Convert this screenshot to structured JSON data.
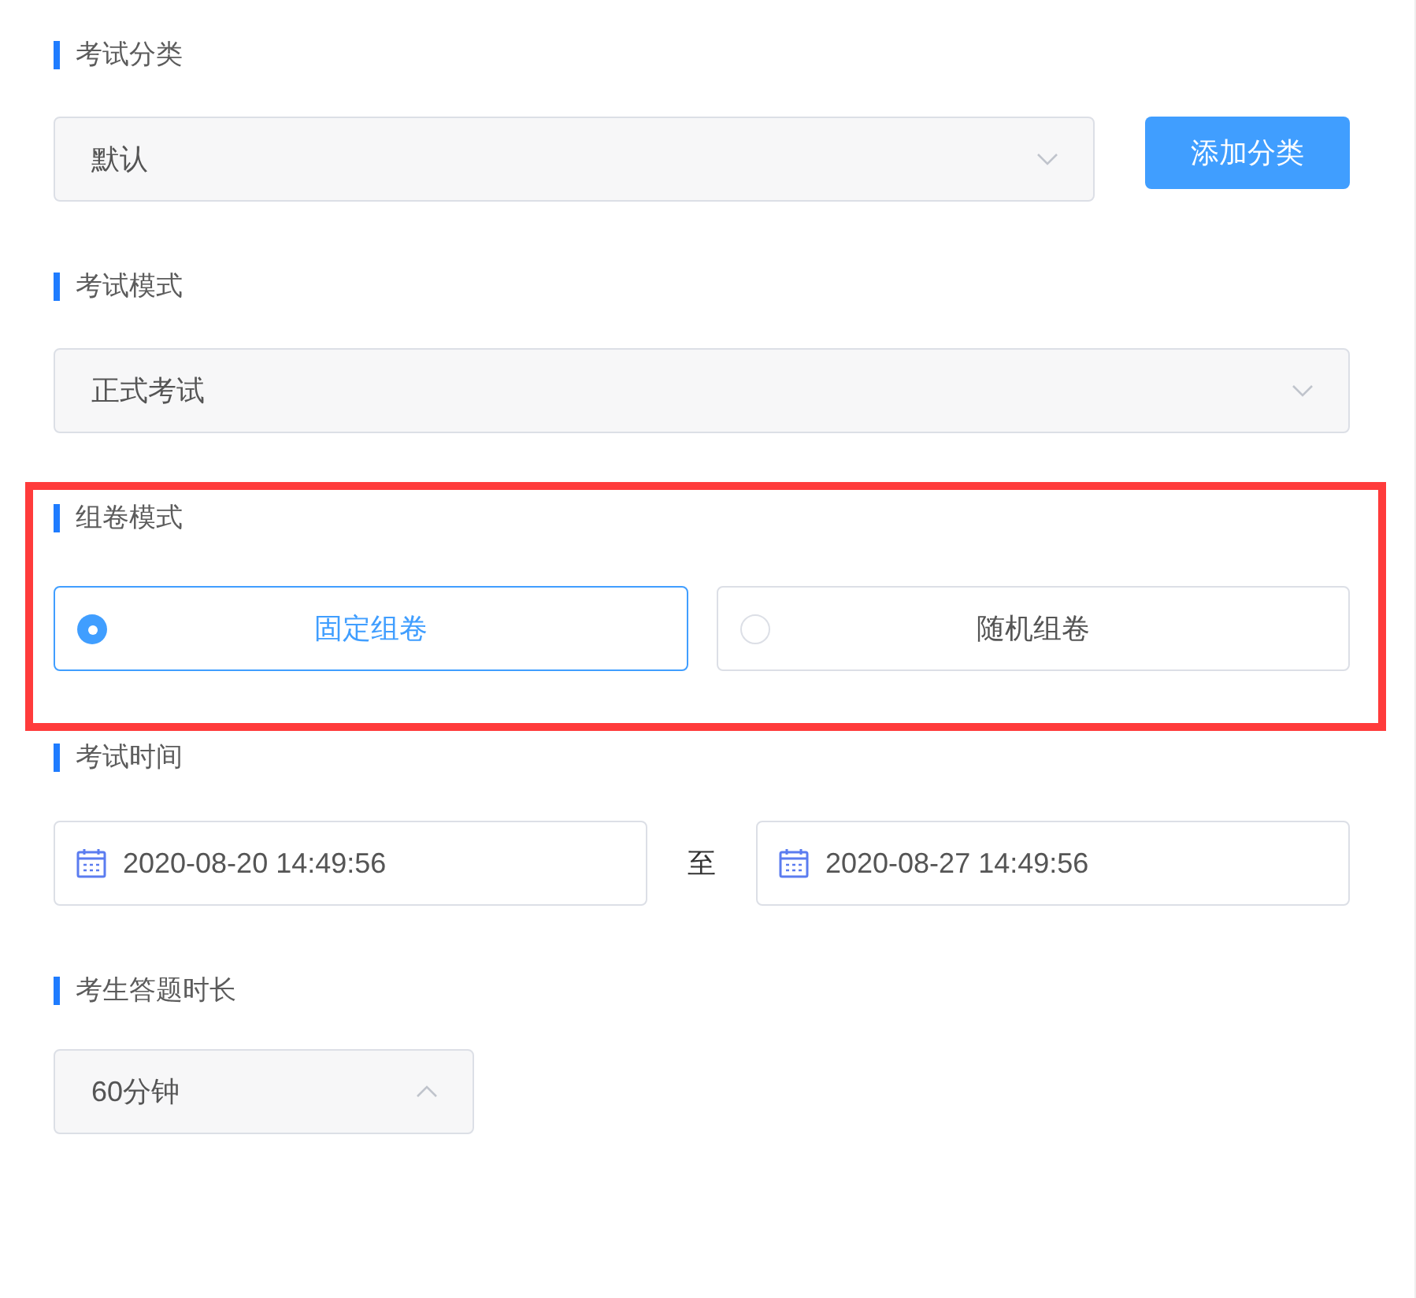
{
  "sections": [
    {
      "kind": "select",
      "label": "考试分类",
      "value": "默认",
      "expanded": false,
      "button": "添加分类",
      "highlighted": false
    },
    {
      "kind": "select",
      "label": "考试模式",
      "value": "正式考试",
      "expanded": false,
      "highlighted": false
    },
    {
      "kind": "radio",
      "label": "组卷模式",
      "options": [
        {
          "label": "固定组卷",
          "selected": true
        },
        {
          "label": "随机组卷",
          "selected": false
        }
      ],
      "highlighted": true
    },
    {
      "kind": "daterange",
      "label": "考试时间",
      "start": "2020-08-20 14:49:56",
      "separator": "至",
      "end": "2020-08-27 14:49:56",
      "highlighted": false
    },
    {
      "kind": "select",
      "label": "考生答题时长",
      "value": "60分钟",
      "expanded": true,
      "highlighted": false
    }
  ]
}
